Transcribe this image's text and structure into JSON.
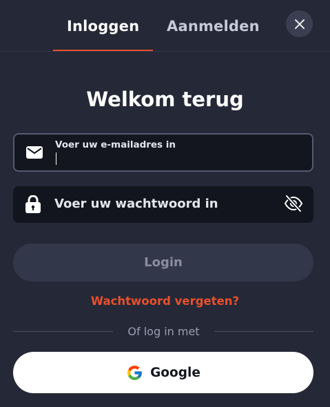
{
  "tabs": {
    "login_label": "Inloggen",
    "register_label": "Aanmelden"
  },
  "close_icon": "close-icon",
  "title": "Welkom terug",
  "email_field": {
    "label": "Voer uw e-mailadres in",
    "value": "",
    "icon": "envelope-icon"
  },
  "password_field": {
    "placeholder": "Voer uw wachtwoord in",
    "value": "",
    "icon": "lock-icon",
    "toggle_icon": "eye-off-icon"
  },
  "login_button": {
    "label": "Login",
    "enabled": false
  },
  "forgot_password": "Wachtwoord vergeten?",
  "divider_text": "Of log in met",
  "google_button": {
    "label": "Google",
    "icon": "google-icon"
  },
  "colors": {
    "background": "#252836",
    "accent": "#e8502d",
    "field_background": "#12151d",
    "button_disabled": "#33374a",
    "google_button": "#ffffff"
  }
}
